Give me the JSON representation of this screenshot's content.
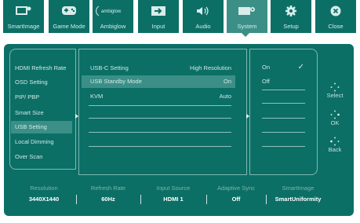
{
  "tabs": [
    {
      "label": "SmartImage",
      "icon": "smartimage-icon",
      "active": false
    },
    {
      "label": "Game Mode",
      "icon": "gamepad-icon",
      "active": false
    },
    {
      "label": "Ambiglow",
      "icon": "ambiglow-logo",
      "active": false,
      "logo_text": "ambiglow"
    },
    {
      "label": "Input",
      "icon": "input-icon",
      "active": false
    },
    {
      "label": "Audio",
      "icon": "speaker-icon",
      "active": false
    },
    {
      "label": "System",
      "icon": "system-icon",
      "active": true
    },
    {
      "label": "Setup",
      "icon": "gear-icon",
      "active": false
    },
    {
      "label": "Close",
      "icon": "close-icon",
      "active": false
    }
  ],
  "menu": [
    {
      "label": "HDMI Refresh Rate",
      "selected": false
    },
    {
      "label": "OSD Setting",
      "selected": false
    },
    {
      "label": "PIP/ PBP",
      "selected": false
    },
    {
      "label": "Smart Size",
      "selected": false
    },
    {
      "label": "USB Setting",
      "selected": true
    },
    {
      "label": "Local Dimming",
      "selected": false
    },
    {
      "label": "Over Scan",
      "selected": false
    }
  ],
  "submenu": [
    {
      "label": "USB-C Setting",
      "value": "High Resolution",
      "selected": false
    },
    {
      "label": "USB Standby Mode",
      "value": "On",
      "selected": true
    },
    {
      "label": "KVM",
      "value": "Auto",
      "selected": false
    }
  ],
  "options": [
    {
      "label": "On",
      "checked": true
    },
    {
      "label": "Off",
      "checked": false
    }
  ],
  "controls": [
    {
      "label": "Select",
      "icon": "select-dpad-icon"
    },
    {
      "label": "OK",
      "icon": "ok-dpad-icon"
    },
    {
      "label": "Back",
      "icon": "back-dpad-icon"
    }
  ],
  "status": [
    {
      "label": "Resolution",
      "value": "3440X1440"
    },
    {
      "label": "Refresh Rate",
      "value": "60Hz"
    },
    {
      "label": "Input Source",
      "value": "HDMI 1"
    },
    {
      "label": "Adaptive Sync",
      "value": "Off"
    },
    {
      "label": "SmartImage",
      "value": "SmartUniformity"
    }
  ],
  "colors": {
    "panel": "#0b6f66",
    "highlight": "#3b8f87",
    "text": "#d3e9e6",
    "status_label": "#7fb3ad"
  }
}
